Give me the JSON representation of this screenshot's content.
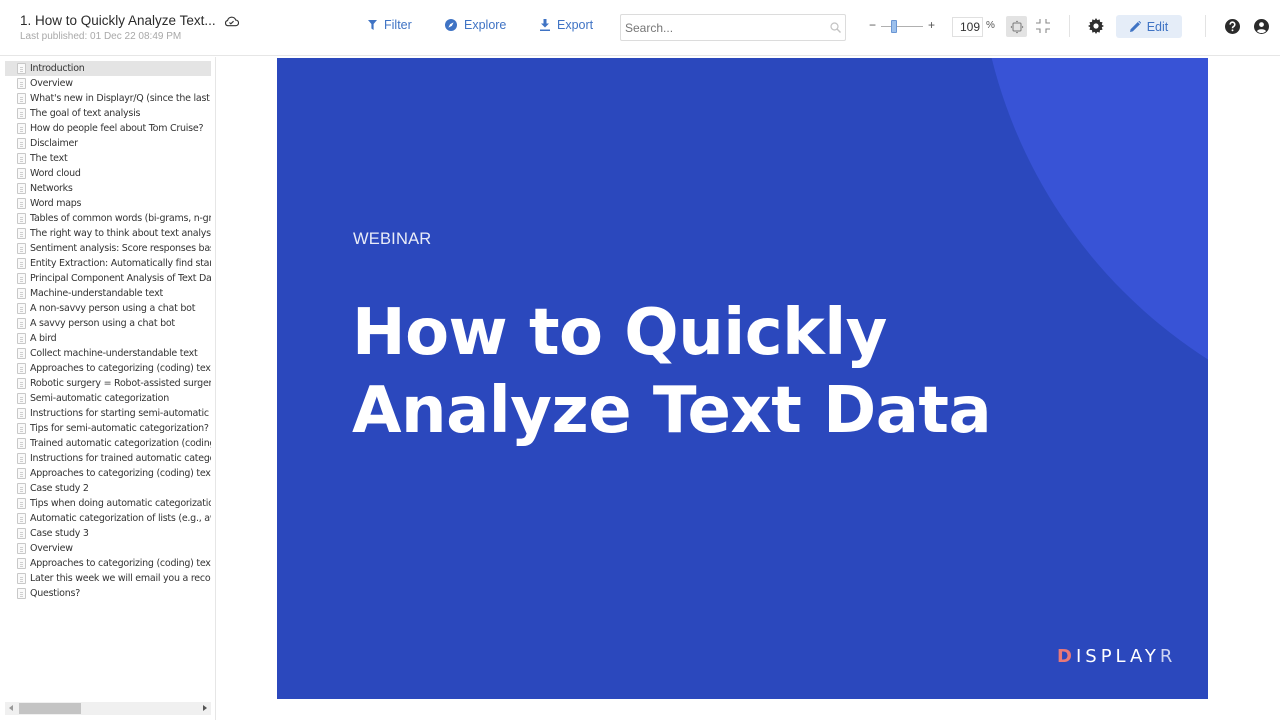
{
  "header": {
    "doc_title": "1. How to Quickly Analyze Text...",
    "last_published": "Last published: 01 Dec 22 08:49 PM",
    "cloud_status_icon": "cloud-check-icon"
  },
  "toolbar": {
    "filter_label": "Filter",
    "explore_label": "Explore",
    "export_label": "Export",
    "search_placeholder": "Search...",
    "search_value": "",
    "zoom_minus": "−",
    "zoom_plus": "+",
    "zoom_value": "109",
    "zoom_unit": "%",
    "edit_label": "Edit",
    "accent_color": "#3f73c4"
  },
  "sidebar": {
    "selected_index": 0,
    "pages": [
      {
        "label": "Introduction"
      },
      {
        "label": "Overview"
      },
      {
        "label": "What's new in Displayr/Q (since the last we"
      },
      {
        "label": "The goal of text analysis"
      },
      {
        "label": "How do people feel about Tom Cruise?"
      },
      {
        "label": "Disclaimer"
      },
      {
        "label": "The text"
      },
      {
        "label": "Word cloud"
      },
      {
        "label": "Networks"
      },
      {
        "label": "Word maps"
      },
      {
        "label": "Tables of common words (bi-grams, n-grar"
      },
      {
        "label": "The right way to think about text analysis: i"
      },
      {
        "label": "Sentiment analysis: Score responses basec"
      },
      {
        "label": "Entity Extraction: Automatically find standa"
      },
      {
        "label": "Principal Component Analysis of Text Data"
      },
      {
        "label": "Machine-understandable text"
      },
      {
        "label": "A non-savvy person using a chat bot"
      },
      {
        "label": "A savvy person using a chat bot"
      },
      {
        "label": "A bird"
      },
      {
        "label": "Collect machine-understandable text"
      },
      {
        "label": "Approaches to categorizing (coding) text da"
      },
      {
        "label": "Robotic surgery = Robot-assisted surgery"
      },
      {
        "label": "Semi-automatic categorization"
      },
      {
        "label": "Instructions for starting semi-automatic ca"
      },
      {
        "label": "Tips for semi-automatic categorization?"
      },
      {
        "label": "Trained automatic categorization (coding)"
      },
      {
        "label": "Instructions for trained automatic categori"
      },
      {
        "label": "Approaches to categorizing (coding) text da"
      },
      {
        "label": "Case study 2"
      },
      {
        "label": "Tips when doing automatic categorization"
      },
      {
        "label": "Automatic categorization of lists (e.g., awar"
      },
      {
        "label": "Case study 3"
      },
      {
        "label": "Overview"
      },
      {
        "label": "Approaches to categorizing (coding) text da"
      },
      {
        "label": "Later this week we will email you a recordi"
      },
      {
        "label": "Questions?"
      }
    ]
  },
  "slide": {
    "kicker": "WEBINAR",
    "title_line1": "How to Quickly",
    "title_line2": "Analyze Text Data",
    "background_color": "#2b48bd",
    "logo_d": "D",
    "logo_mid": "ISPLAY",
    "logo_r": "R"
  }
}
